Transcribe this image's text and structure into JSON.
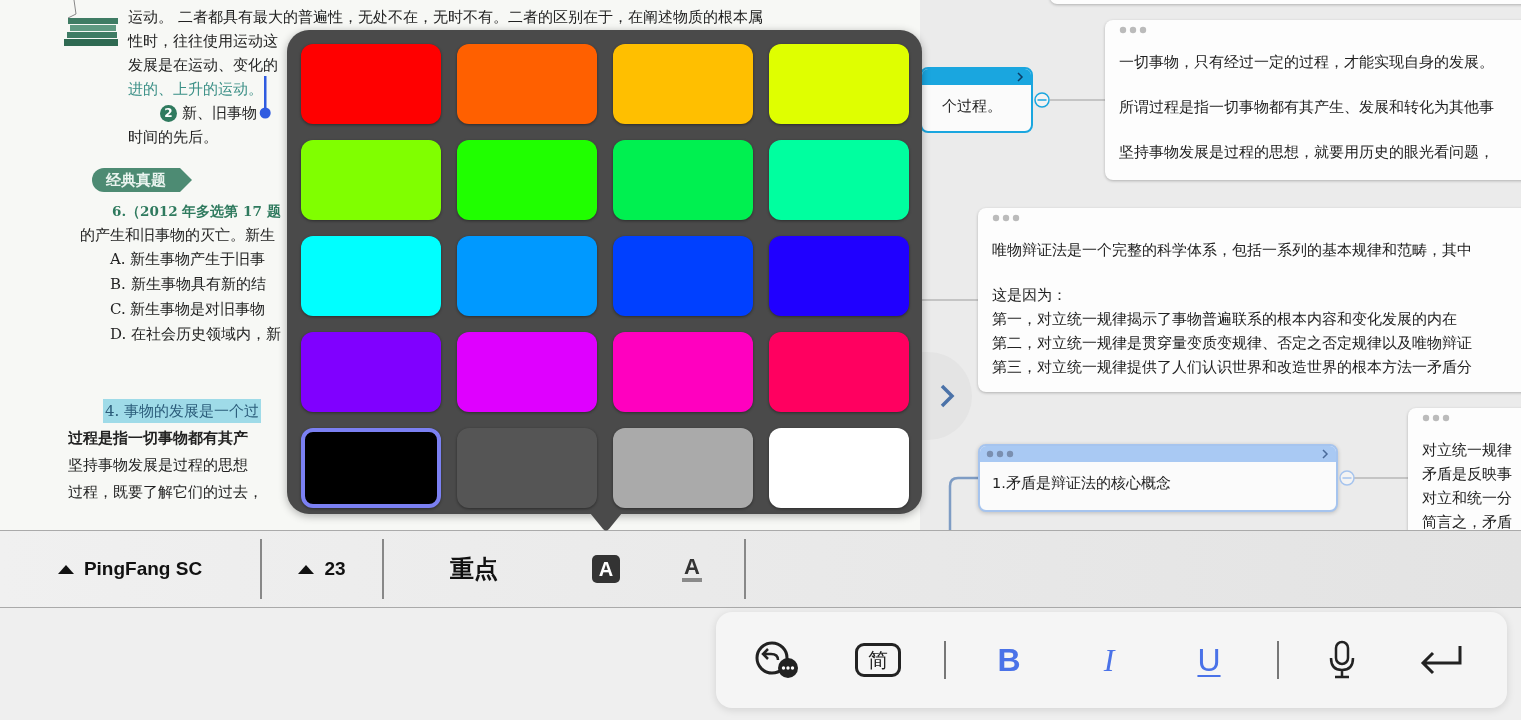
{
  "document": {
    "lines": [
      {
        "kind": "body",
        "text": "运动。 二者都具有最大的普遍性，无处不在，无时不有。二者的区别在于，在阐述物质的根本属"
      },
      {
        "kind": "body",
        "text": "性时，往往使用运动这"
      },
      {
        "kind": "body",
        "text": "发展是在运动、变化的"
      },
      {
        "kind": "accent",
        "text": "进的、上升的运动。"
      },
      {
        "kind": "step",
        "number": "2",
        "text": "新、旧事物"
      },
      {
        "kind": "body",
        "text": "时间的先后。"
      },
      {
        "kind": "badge",
        "text": "经典真题"
      },
      {
        "kind": "question",
        "text": "6.（2012 年多选第 17 题"
      },
      {
        "kind": "stem",
        "text": "的产生和旧事物的灭亡。新生"
      },
      {
        "kind": "option",
        "text": "A. 新生事物产生于旧事"
      },
      {
        "kind": "option",
        "text": "B. 新生事物具有新的结"
      },
      {
        "kind": "option",
        "text": "C. 新生事物是对旧事物"
      },
      {
        "kind": "option",
        "text": "D. 在社会历史领域内，新"
      },
      {
        "kind": "heading",
        "text": "4. 事物的发展是一个过"
      },
      {
        "kind": "lead",
        "text": "过程是指一切事物都有其产"
      },
      {
        "kind": "para",
        "text": "坚持事物发展是过程的思想"
      },
      {
        "kind": "para",
        "text": "过程，既要了解它们的过去，"
      }
    ]
  },
  "palette": {
    "swatches": [
      {
        "color": "#ff0000",
        "selected": false
      },
      {
        "color": "#ff6000",
        "selected": false
      },
      {
        "color": "#ffbf00",
        "selected": false
      },
      {
        "color": "#dfff00",
        "selected": false
      },
      {
        "color": "#80ff00",
        "selected": false
      },
      {
        "color": "#20ff00",
        "selected": false
      },
      {
        "color": "#00f050",
        "selected": false
      },
      {
        "color": "#00ff9f",
        "selected": false
      },
      {
        "color": "#00ffff",
        "selected": false
      },
      {
        "color": "#0099ff",
        "selected": false
      },
      {
        "color": "#0040ff",
        "selected": false
      },
      {
        "color": "#2000ff",
        "selected": false
      },
      {
        "color": "#8000ff",
        "selected": false
      },
      {
        "color": "#df00ff",
        "selected": false
      },
      {
        "color": "#ff00bf",
        "selected": false
      },
      {
        "color": "#ff0060",
        "selected": false
      },
      {
        "color": "#000000",
        "selected": true
      },
      {
        "color": "#555555",
        "selected": false
      },
      {
        "color": "#aaaaaa",
        "selected": false
      },
      {
        "color": "#ffffff",
        "selected": false
      }
    ]
  },
  "mindmap": {
    "topics": [
      {
        "text": "个过程。",
        "selected": true
      },
      {
        "text": "1.矛盾是辩证法的核心概念",
        "selected": false
      }
    ],
    "cards": [
      {
        "paragraphs": [
          [
            "一切事物，只有经过一定的过程，才能实现自身的发展。"
          ],
          [
            "所谓过程是指一切事物都有其产生、发展和转化为其他事"
          ],
          [
            "坚持事物发展是过程的思想，就要用历史的眼光看问题，"
          ]
        ]
      },
      {
        "paragraphs": [
          [
            "唯物辩证法是一个完整的科学体系，包括一系列的基本规律和范畴，其中"
          ],
          [
            "这是因为：",
            "第一，对立统一规律揭示了事物普遍联系的根本内容和变化发展的内在",
            "第二，对立统一规律是贯穿量变质变规律、否定之否定规律以及唯物辩证",
            "第三，对立统一规律提供了人们认识世界和改造世界的根本方法一矛盾分"
          ]
        ]
      },
      {
        "paragraphs": [
          [
            "对立统一规律",
            "矛盾是反映事",
            "对立和统一分",
            "简言之，矛盾"
          ]
        ]
      }
    ]
  },
  "toolbar": {
    "font": "PingFang SC",
    "size": "23",
    "highlight": "重点",
    "text_color_glyph": "A",
    "underline_glyph": "A"
  },
  "keyboard_bar": {
    "simplified": "简",
    "bold": "B",
    "italic": "I",
    "underline": "U"
  }
}
